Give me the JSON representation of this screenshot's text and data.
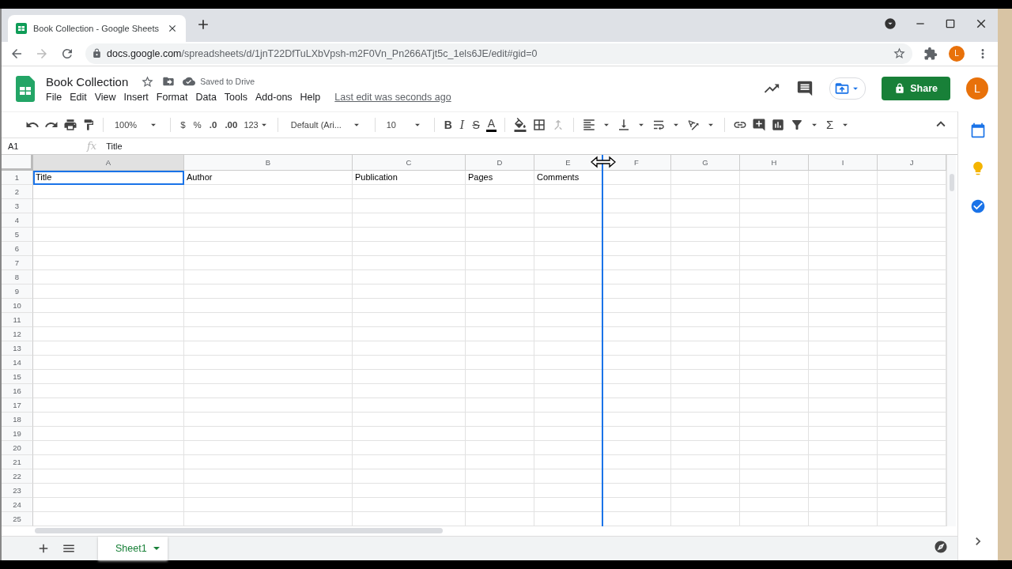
{
  "browser": {
    "tab": {
      "title": "Book Collection - Google Sheets",
      "selected": true
    },
    "url": {
      "domain": "docs.google.com",
      "path": "/spreadsheets/d/1jnT22DfTuLXbVpsh-m2F0Vn_Pn266ATjt5c_1els6JE/edit#gid=0"
    },
    "profile_initial": "L"
  },
  "document": {
    "title": "Book Collection",
    "save_status": "Saved to Drive",
    "last_edit": "Last edit was seconds ago"
  },
  "menu": [
    "File",
    "Edit",
    "View",
    "Insert",
    "Format",
    "Data",
    "Tools",
    "Add-ons",
    "Help"
  ],
  "share_button": "Share",
  "account_initial": "L",
  "toolbar": {
    "zoom": "100%",
    "currency": "$",
    "percent": "%",
    "decrease_decimals": ".0",
    "increase_decimals": ".00",
    "number_format": "123",
    "font": "Default (Ari...",
    "font_size": "10",
    "bold": "B",
    "italic": "I",
    "strikethrough": "S",
    "text_color": "A",
    "functions": "Σ"
  },
  "formula_bar": {
    "cell": "A1",
    "fx": "fx",
    "formula": "Title"
  },
  "columns": [
    {
      "label": "A",
      "selected": true
    },
    {
      "label": "B",
      "selected": false
    },
    {
      "label": "C",
      "selected": false
    },
    {
      "label": "D",
      "selected": false
    },
    {
      "label": "E",
      "selected": false
    },
    {
      "label": "F",
      "selected": false
    },
    {
      "label": "G",
      "selected": false
    },
    {
      "label": "H",
      "selected": false
    },
    {
      "label": "I",
      "selected": false
    },
    {
      "label": "J",
      "selected": false
    }
  ],
  "rows": [
    {
      "number": "1",
      "cells": [
        "Title",
        "Author",
        "Publication",
        "Pages",
        "Comments"
      ]
    },
    {
      "number": "2"
    },
    {
      "number": "3"
    },
    {
      "number": "4"
    },
    {
      "number": "5"
    },
    {
      "number": "6"
    },
    {
      "number": "7"
    },
    {
      "number": "8"
    },
    {
      "number": "9"
    },
    {
      "number": "10"
    },
    {
      "number": "11"
    },
    {
      "number": "12"
    },
    {
      "number": "13"
    },
    {
      "number": "14"
    },
    {
      "number": "15"
    },
    {
      "number": "16"
    },
    {
      "number": "17"
    },
    {
      "number": "18"
    },
    {
      "number": "19"
    },
    {
      "number": "20"
    },
    {
      "number": "21"
    },
    {
      "number": "22"
    },
    {
      "number": "23"
    },
    {
      "number": "24"
    },
    {
      "number": "25"
    }
  ],
  "sheets": [
    {
      "name": "Sheet1",
      "selected": true
    }
  ]
}
